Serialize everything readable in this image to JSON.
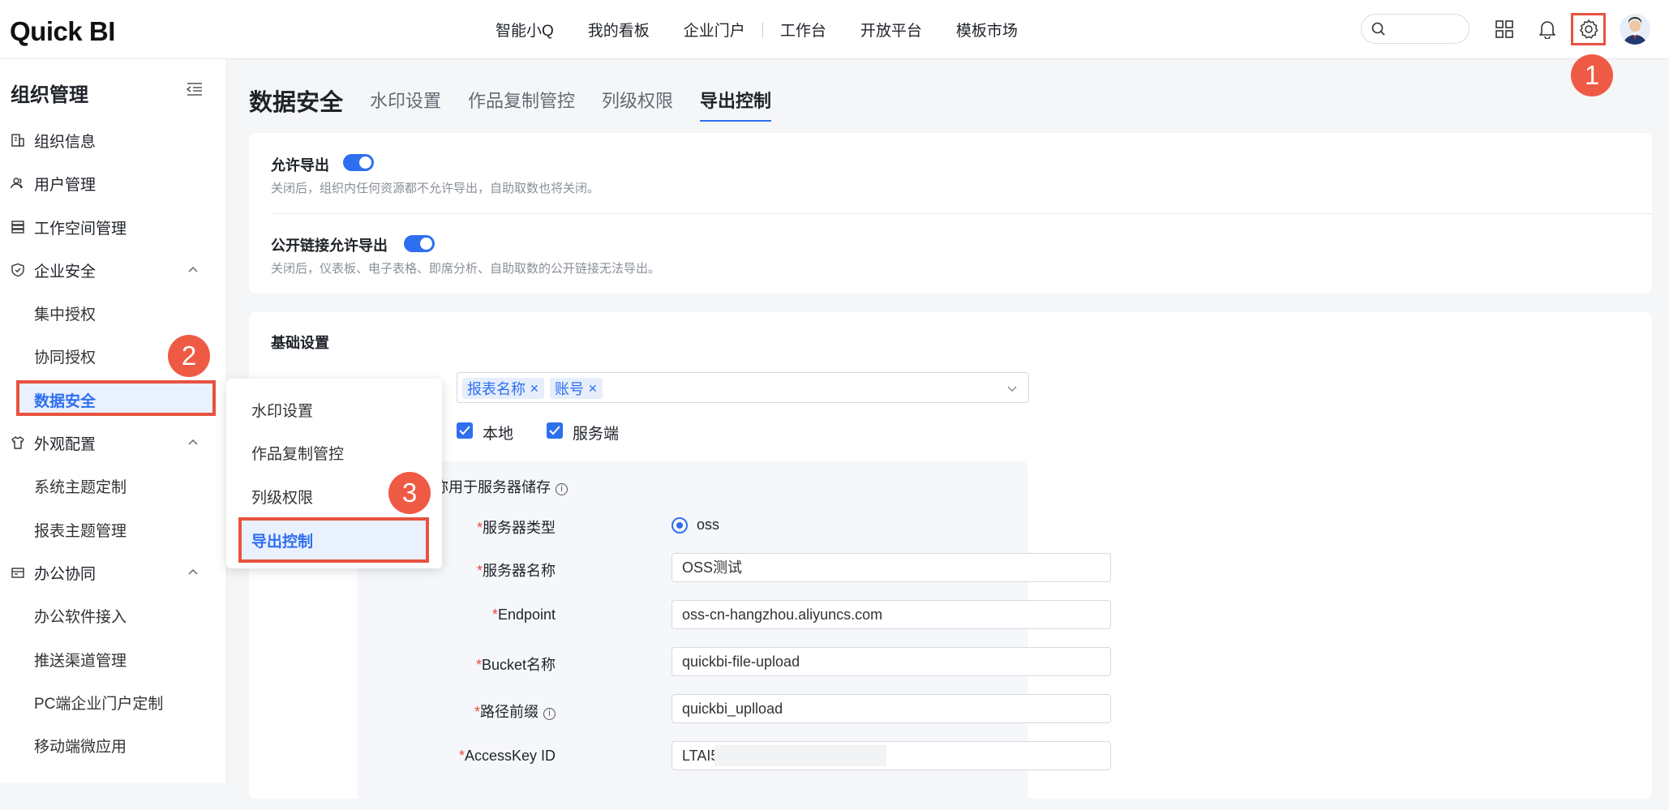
{
  "app": {
    "logo": "Quick BI"
  },
  "topnav": {
    "items": [
      "智能小Q",
      "我的看板",
      "企业门户",
      "工作台",
      "开放平台",
      "模板市场"
    ],
    "icons": [
      "search-icon",
      "apps-grid-icon",
      "bell-icon",
      "gear-icon",
      "avatar"
    ]
  },
  "badges": {
    "b1": "1",
    "b2": "2",
    "b3": "3"
  },
  "sidebar": {
    "title": "组织管理",
    "items": [
      {
        "label": "组织信息",
        "icon": "org-icon"
      },
      {
        "label": "用户管理",
        "icon": "users-icon"
      },
      {
        "label": "工作空间管理",
        "icon": "workspace-icon"
      },
      {
        "label": "企业安全",
        "icon": "shield-icon"
      },
      {
        "label": "集中授权"
      },
      {
        "label": "协同授权"
      },
      {
        "label": "数据安全"
      },
      {
        "label": "外观配置",
        "icon": "shirt-icon"
      },
      {
        "label": "系统主题定制"
      },
      {
        "label": "报表主题管理"
      },
      {
        "label": "办公协同",
        "icon": "office-icon"
      },
      {
        "label": "办公软件接入"
      },
      {
        "label": "推送渠道管理"
      },
      {
        "label": "PC端企业门户定制"
      },
      {
        "label": "移动端微应用"
      }
    ]
  },
  "page": {
    "title": "数据安全",
    "tabs": [
      "水印设置",
      "作品复制管控",
      "列级权限",
      "导出控制"
    ],
    "active_tab": "导出控制"
  },
  "export": {
    "allow_title": "允许导出",
    "allow_desc": "关闭后，组织内任何资源都不允许导出，自助取数也将关闭。",
    "public_title": "公开链接允许导出",
    "public_desc": "关闭后，仪表板、电子表格、即席分析、自助取数的公开链接无法导出。"
  },
  "basic": {
    "title": "基础设置",
    "tags": [
      "报表名称",
      "账号"
    ],
    "checkboxes": [
      "本地",
      "服务端"
    ],
    "panel_header": "名称用于服务器储存",
    "server_type_label": "服务器类型",
    "server_type_value": "oss",
    "server_name_label": "服务器名称",
    "server_name_value": "OSS测试",
    "endpoint_label": "Endpoint",
    "endpoint_value": "oss-cn-hangzhou.aliyuncs.com",
    "bucket_label": "Bucket名称",
    "bucket_value": "quickbi-file-upload",
    "prefix_label": "路径前缀",
    "prefix_value": "quickbi_uplload",
    "akid_label": "AccessKey ID",
    "akid_value": "LTAI5"
  },
  "flyout": {
    "items": [
      "水印设置",
      "作品复制管控",
      "列级权限",
      "导出控制"
    ]
  },
  "colors": {
    "accent": "#2e6ff0",
    "highlight": "#e8523f"
  }
}
